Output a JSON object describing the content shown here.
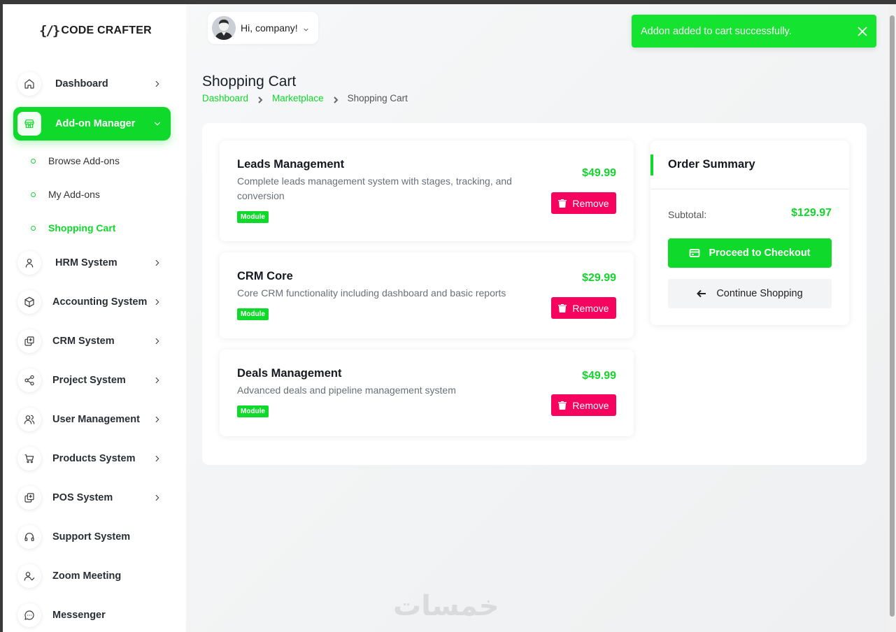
{
  "brand": {
    "logo_mark": "{/}",
    "name": "CODE CRAFTER"
  },
  "user": {
    "greeting": "Hi, company!"
  },
  "toast": {
    "message": "Addon added to cart successfully."
  },
  "sidebar": {
    "items": [
      {
        "label": "Dashboard",
        "icon": "home-icon"
      },
      {
        "label": "Add-on Manager",
        "icon": "store-icon"
      },
      {
        "label": "HRM System",
        "icon": "user-icon"
      },
      {
        "label": "Accounting System",
        "icon": "box-icon"
      },
      {
        "label": "CRM System",
        "icon": "layers-icon"
      },
      {
        "label": "Project System",
        "icon": "share-icon"
      },
      {
        "label": "User Management",
        "icon": "users-icon"
      },
      {
        "label": "Products System",
        "icon": "cart-icon"
      },
      {
        "label": "POS System",
        "icon": "layers-icon"
      },
      {
        "label": "Support System",
        "icon": "headset-icon"
      },
      {
        "label": "Zoom Meeting",
        "icon": "user-check-icon"
      },
      {
        "label": "Messenger",
        "icon": "chat-icon"
      }
    ],
    "submenu": [
      {
        "label": "Browse Add-ons"
      },
      {
        "label": "My Add-ons"
      },
      {
        "label": "Shopping Cart"
      }
    ]
  },
  "page": {
    "title": "Shopping Cart",
    "breadcrumb": [
      "Dashboard",
      "Marketplace",
      "Shopping Cart"
    ]
  },
  "cart": {
    "items": [
      {
        "name": "Leads Management",
        "description": "Complete leads management system with stages, tracking, and conversion",
        "badge": "Module",
        "price": "$49.99",
        "remove_label": "Remove"
      },
      {
        "name": "CRM Core",
        "description": "Core CRM functionality including dashboard and basic reports",
        "badge": "Module",
        "price": "$29.99",
        "remove_label": "Remove"
      },
      {
        "name": "Deals Management",
        "description": "Advanced deals and pipeline management system",
        "badge": "Module",
        "price": "$49.99",
        "remove_label": "Remove"
      }
    ]
  },
  "summary": {
    "title": "Order Summary",
    "subtotal_label": "Subtotal:",
    "subtotal_value": "$129.97",
    "checkout_label": "Proceed to Checkout",
    "continue_label": "Continue Shopping"
  },
  "watermark": "خمسات",
  "colors": {
    "accent": "#0fd92a",
    "toast": "#14e42f",
    "price": "#14d42d",
    "danger": "#f5035f"
  }
}
